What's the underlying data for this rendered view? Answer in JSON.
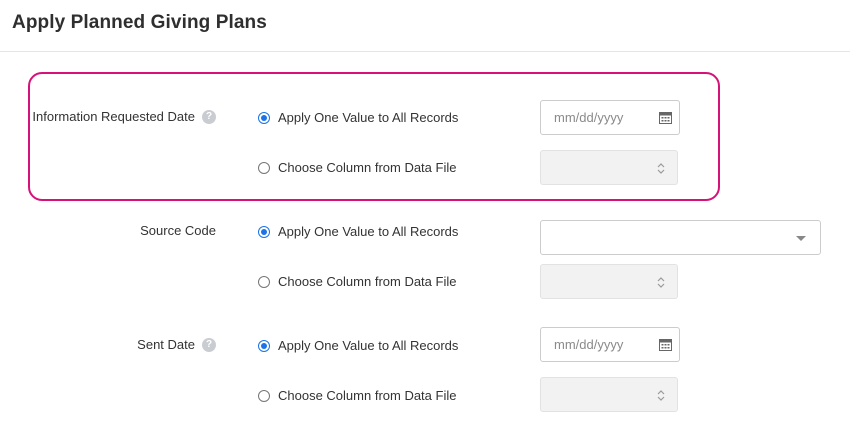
{
  "page": {
    "title": "Apply Planned Giving Plans"
  },
  "fields": [
    {
      "label": "Information Requested Date",
      "has_help": true,
      "option_apply": "Apply One Value to All Records",
      "option_column": "Choose Column from Data File",
      "selected": "apply",
      "input": {
        "type": "date",
        "placeholder": "mm/dd/yyyy",
        "icon": "calendar-icon"
      }
    },
    {
      "label": "Source Code",
      "has_help": false,
      "option_apply": "Apply One Value to All Records",
      "option_column": "Choose Column from Data File",
      "selected": "apply",
      "input": {
        "type": "dropdown",
        "value": "",
        "icon": "chevron-down-icon"
      }
    },
    {
      "label": "Sent Date",
      "has_help": true,
      "option_apply": "Apply One Value to All Records",
      "option_column": "Choose Column from Data File",
      "selected": "apply",
      "input": {
        "type": "date",
        "placeholder": "mm/dd/yyyy",
        "icon": "calendar-icon"
      }
    }
  ],
  "help_icon": {
    "glyph": "?",
    "name": "help-icon"
  },
  "colors": {
    "highlight": "#d6127a",
    "radio_selected": "#1a73e8",
    "disabled_bg": "#f2f2f2",
    "border": "#cccccc"
  }
}
